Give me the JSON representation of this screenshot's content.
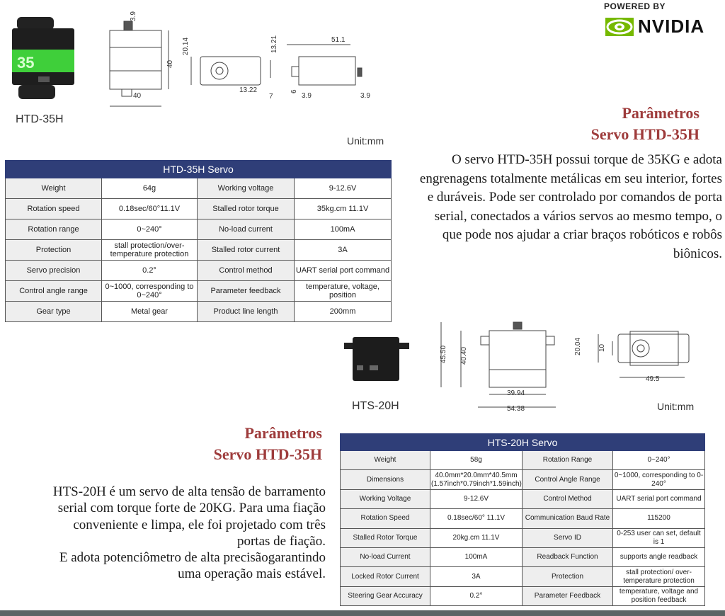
{
  "brand": {
    "powered_by": "POWERED BY",
    "name": "NVIDIA",
    "color": "#76b900"
  },
  "htd35h": {
    "model": "HTD-35H",
    "unit": "Unit:mm",
    "dims": [
      "3.9",
      "40",
      "40",
      "20.14",
      "13.21",
      "13.22",
      "7",
      "51.1",
      "6",
      "3.9",
      "3.9"
    ],
    "heading_line1": "Parâmetros",
    "heading_line2": "Servo HTD-35H",
    "description": "O servo HTD-35H possui torque de 35KG e adota engrenagens totalmente metálicas em seu interior, fortes e duráveis. Pode ser controlado por comandos de porta serial, conectados a vários servos ao mesmo tempo, o que pode nos ajudar a criar braços robóticos e robôs biônicos.",
    "table": {
      "title": "HTD-35H Servo",
      "rows": [
        [
          "Weight",
          "64g",
          "Working voltage",
          "9-12.6V"
        ],
        [
          "Rotation speed",
          "0.18sec/60°11.1V",
          "Stalled rotor torque",
          "35kg.cm 11.1V"
        ],
        [
          "Rotation range",
          "0~240°",
          "No-load current",
          "100mA"
        ],
        [
          "Protection",
          "stall protection/over-temperature protection",
          "Stalled rotor current",
          "3A"
        ],
        [
          "Servo precision",
          "0.2°",
          "Control method",
          "UART serial port command"
        ],
        [
          "Control angle range",
          "0~1000, corresponding to 0~240°",
          "Parameter feedback",
          "temperature, voltage, position"
        ],
        [
          "Gear type",
          "Metal gear",
          "Product line length",
          "200mm"
        ]
      ]
    }
  },
  "hts20h": {
    "model": "HTS-20H",
    "unit": "Unit:mm",
    "dims": [
      "45.50",
      "40.40",
      "39.94",
      "54.38",
      "20.04",
      "10",
      "49.5"
    ],
    "heading_line1": "Parâmetros",
    "heading_line2": "Servo HTD-35H",
    "description_lines": [
      "HTS-20H é um servo de alta tensão de barramento",
      "serial com torque forte de 20KG. Para uma fiação",
      "conveniente e limpa, ele foi projetado com três",
      "portas de fiação.",
      "E adota potenciômetro de alta precisãogarantindo",
      "uma operação mais estável."
    ],
    "table": {
      "title": "HTS-20H Servo",
      "rows": [
        [
          "Weight",
          "58g",
          "Rotation Range",
          "0~240°"
        ],
        [
          "Dimensions",
          "40.0mm*20.0mm*40.5mm (1.57inch*0.79inch*1.59inch)",
          "Control Angle Range",
          "0~1000, corresponding to 0-240°"
        ],
        [
          "Working Voltage",
          "9-12.6V",
          "Control Method",
          "UART serial port command"
        ],
        [
          "Rotation Speed",
          "0.18sec/60° 11.1V",
          "Communication Baud Rate",
          "115200"
        ],
        [
          "Stalled Rotor Torque",
          "20kg.cm 11.1V",
          "Servo ID",
          "0-253 user can set, default is 1"
        ],
        [
          "No-load Current",
          "100mA",
          "Readback Function",
          "supports angle readback"
        ],
        [
          "Locked Rotor Current",
          "3A",
          "Protection",
          "stall protection/ over-temperature protection"
        ],
        [
          "Steering Gear Accuracy",
          "0.2°",
          "Parameter Feedback",
          "temperature, voltage and position feedback"
        ]
      ]
    }
  },
  "colors": {
    "header_navy": "#2f3e78",
    "heading_red": "#9e3b3b",
    "servo_green": "#3fcf3a"
  }
}
